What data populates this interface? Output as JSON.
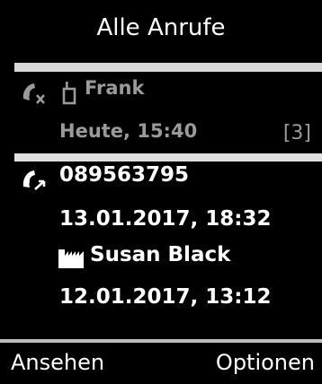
{
  "header": {
    "title": "Alle Anrufe"
  },
  "calls": [
    {
      "type_icon": "missed-call-icon",
      "source_icon": "handset-icon",
      "name": "Frank",
      "time": "Heute, 15:40",
      "count": "[3]",
      "selected": false
    },
    {
      "type_icon": "outgoing-call-icon",
      "number": "089563795",
      "time": "13.01.2017, 18:32"
    },
    {
      "source_icon": "office-building-icon",
      "name": "Susan Black",
      "time": "12.01.2017, 13:12"
    }
  ],
  "softkeys": {
    "left": "Ansehen",
    "right": "Optionen"
  },
  "colors": {
    "background": "#000000",
    "text": "#ffffff",
    "dim_text": "#9a9a9a",
    "separator": "#d8d8d8"
  }
}
